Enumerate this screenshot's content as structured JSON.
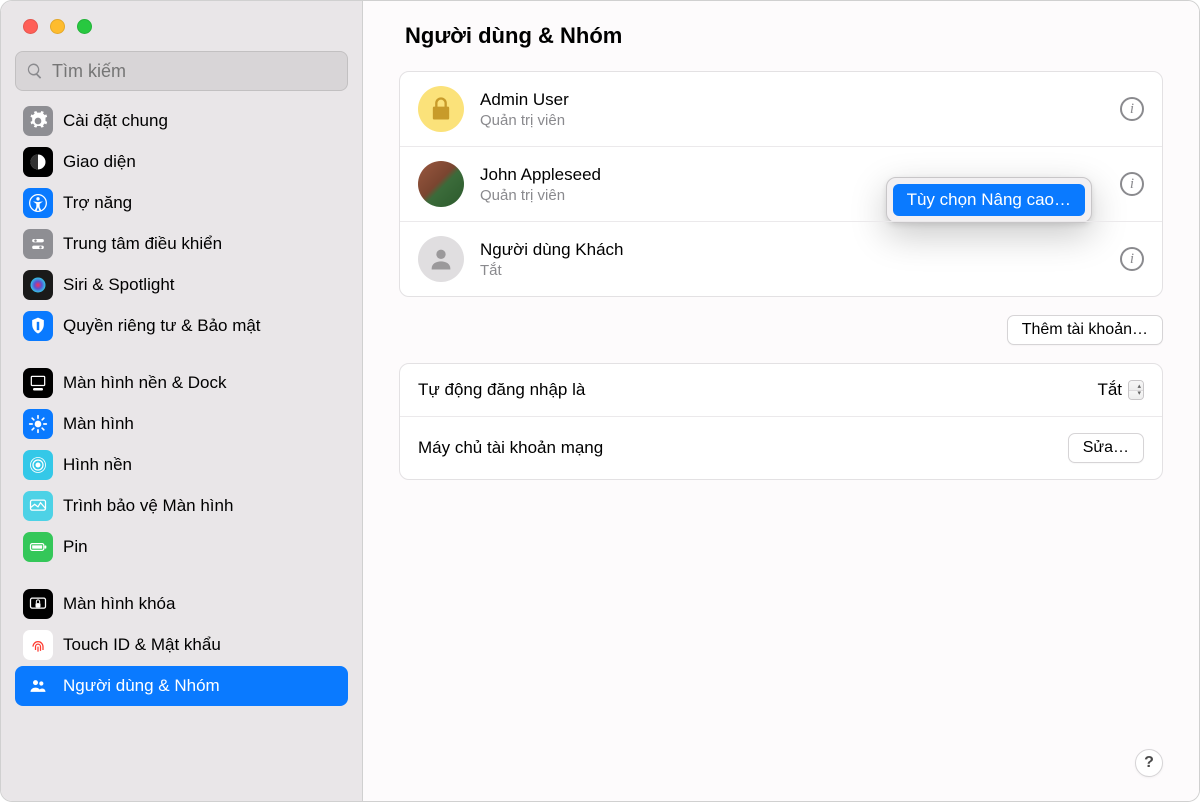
{
  "search": {
    "placeholder": "Tìm kiếm"
  },
  "sidebar": {
    "items": [
      {
        "label": "Cài đặt chung",
        "icon": "gear",
        "bg": "#8e8e93"
      },
      {
        "label": "Giao diện",
        "icon": "appearance",
        "bg": "#000"
      },
      {
        "label": "Trợ năng",
        "icon": "accessibility",
        "bg": "#0a7aff"
      },
      {
        "label": "Trung tâm điều khiển",
        "icon": "control-center",
        "bg": "#8e8e93"
      },
      {
        "label": "Siri & Spotlight",
        "icon": "siri",
        "bg": "#1a1a1a"
      },
      {
        "label": "Quyền riêng tư & Bảo mật",
        "icon": "privacy",
        "bg": "#0a7aff"
      }
    ],
    "items2": [
      {
        "label": "Màn hình nền & Dock",
        "icon": "dock",
        "bg": "#000"
      },
      {
        "label": "Màn hình",
        "icon": "displays",
        "bg": "#0a7aff"
      },
      {
        "label": "Hình nền",
        "icon": "wallpaper",
        "bg": "#34c8e8"
      },
      {
        "label": "Trình bảo vệ Màn hình",
        "icon": "screensaver",
        "bg": "#4dd2e6"
      },
      {
        "label": "Pin",
        "icon": "battery",
        "bg": "#34c759"
      }
    ],
    "items3": [
      {
        "label": "Màn hình khóa",
        "icon": "lockscreen",
        "bg": "#000"
      },
      {
        "label": "Touch ID & Mật khẩu",
        "icon": "touchid",
        "bg": "#fff"
      },
      {
        "label": "Người dùng & Nhóm",
        "icon": "users",
        "bg": "#0a7aff",
        "selected": true
      }
    ]
  },
  "main": {
    "title": "Người dùng & Nhóm",
    "users": [
      {
        "name": "Admin User",
        "role": "Quản trị viên",
        "avatar": "lock"
      },
      {
        "name": "John Appleseed",
        "role": "Quản trị viên",
        "avatar": "photo"
      },
      {
        "name": "Người dùng Khách",
        "role": "Tắt",
        "avatar": "guest"
      }
    ],
    "context_menu": {
      "advanced_options": "Tùy chọn Nâng cao…"
    },
    "add_account": "Thêm tài khoản…",
    "auto_login_label": "Tự động đăng nhập là",
    "auto_login_value": "Tắt",
    "network_label": "Máy chủ tài khoản mạng",
    "network_button": "Sửa…",
    "help": "?"
  }
}
